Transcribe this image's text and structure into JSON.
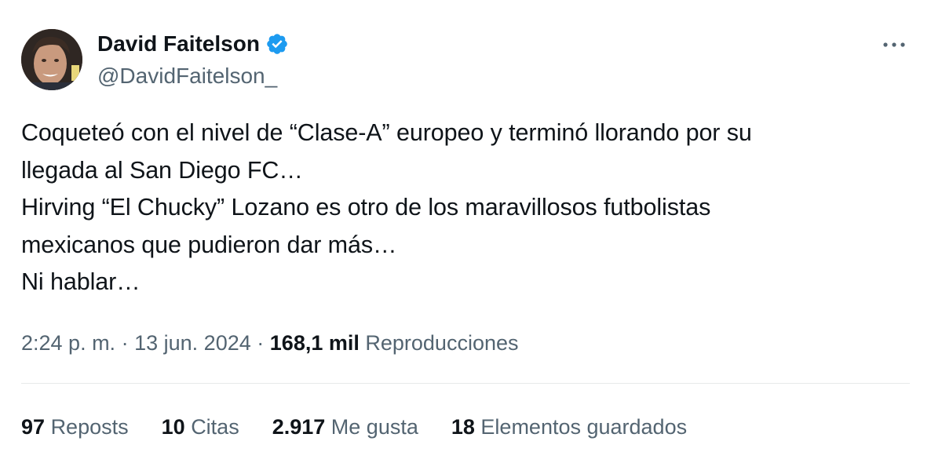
{
  "author": {
    "name": "David Faitelson",
    "handle": "@DavidFaitelson_",
    "verified": true
  },
  "menu_icon": "more-horizontal-icon",
  "tweet": {
    "text": "Coqueteó con el nivel de “Clase-A” europeo y terminó llorando por su\nllegada al San Diego FC…\nHirving “El Chucky” Lozano es otro de los maravillosos futbolistas\nmexicanos que pudieron dar más…\nNi hablar…"
  },
  "meta": {
    "time": "2:24 p. m.",
    "separator": "·",
    "date": "13 jun. 2024",
    "views_count": "168,1 mil",
    "views_label": "Reproducciones"
  },
  "stats": [
    {
      "count": "97",
      "label": "Reposts"
    },
    {
      "count": "10",
      "label": "Citas"
    },
    {
      "count": "2.917",
      "label": "Me gusta"
    },
    {
      "count": "18",
      "label": "Elementos guardados"
    }
  ],
  "colors": {
    "text": "#0f1419",
    "secondary": "#536471",
    "verified": "#1d9bf0",
    "divider": "#e7e9ea"
  }
}
